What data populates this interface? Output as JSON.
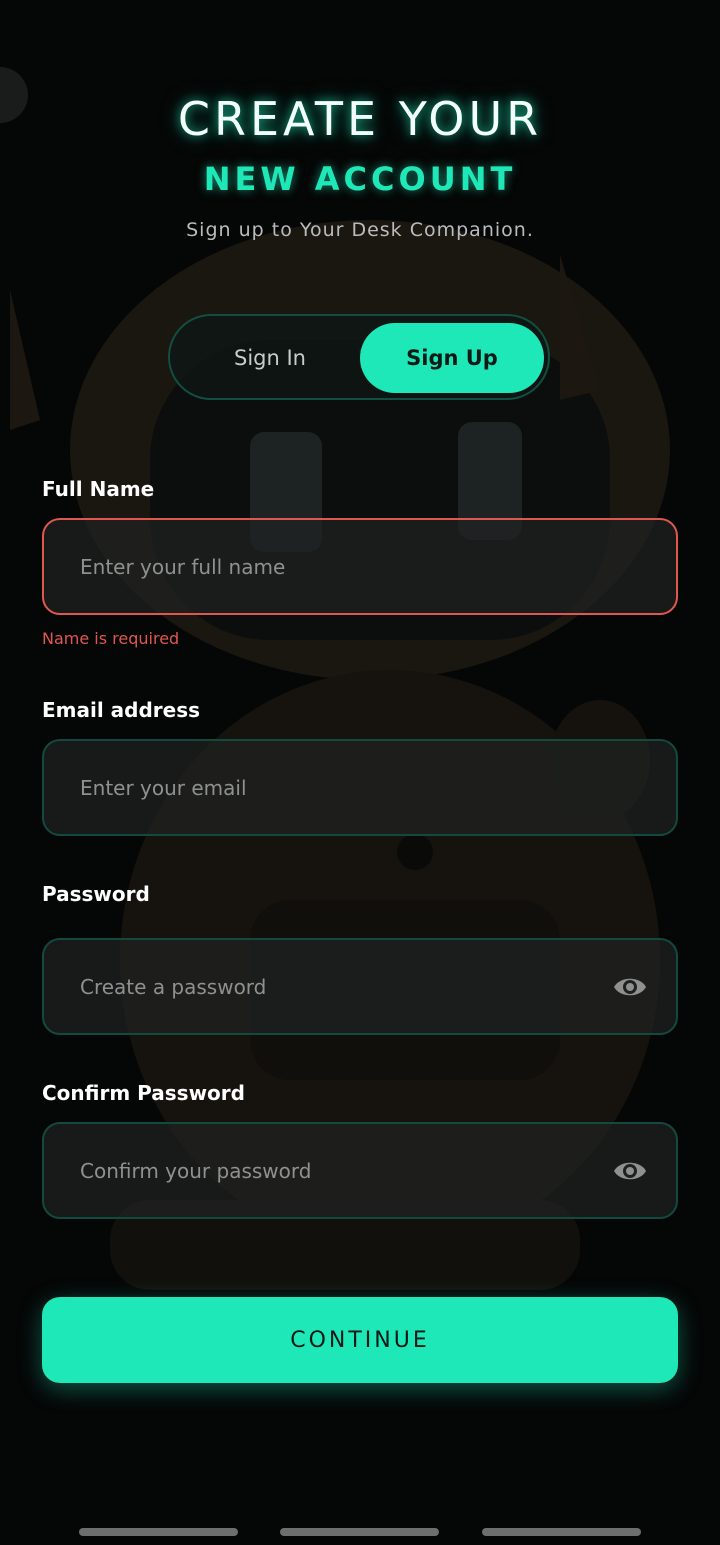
{
  "header": {
    "title_line1": "CREATE YOUR",
    "title_line2": "NEW ACCOUNT",
    "subtitle": "Sign up to Your Desk Companion."
  },
  "auth_toggle": {
    "sign_in_label": "Sign In",
    "sign_up_label": "Sign Up",
    "selected": "Sign Up"
  },
  "form": {
    "full_name": {
      "label": "Full Name",
      "placeholder": "Enter your full name",
      "value": "",
      "error": "Name is required"
    },
    "email": {
      "label": "Email address",
      "placeholder": "Enter your email",
      "value": ""
    },
    "password": {
      "label": "Password",
      "placeholder": "Create a password",
      "value": "",
      "toggle_icon": "eye-icon"
    },
    "confirm_password": {
      "label": "Confirm Password",
      "placeholder": "Confirm your password",
      "value": "",
      "toggle_icon": "eye-icon"
    },
    "submit_label": "CONTINUE"
  },
  "colors": {
    "accent": "#1ee8b7",
    "error": "#e0574f",
    "background": "#050606",
    "input_border": "#124a3d"
  }
}
